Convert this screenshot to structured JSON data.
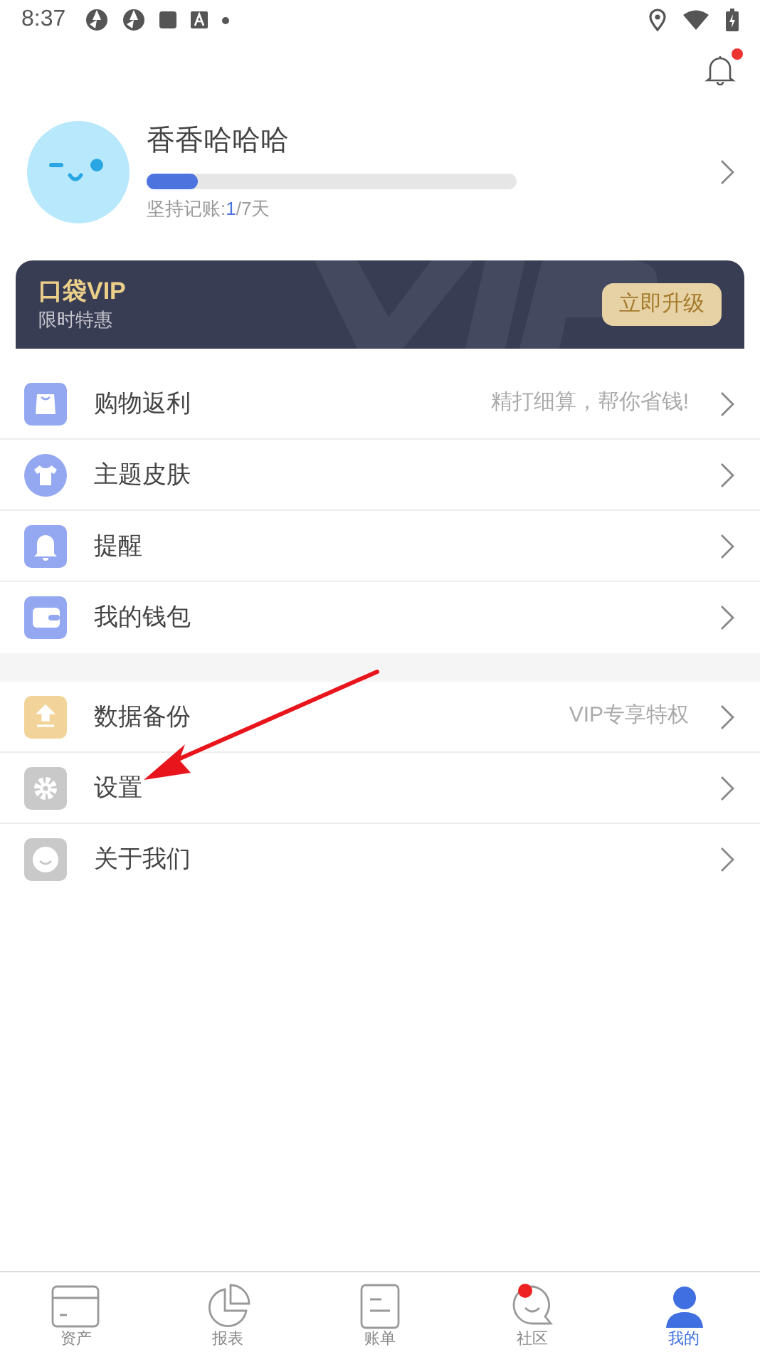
{
  "status_bar": {
    "time": "8:37"
  },
  "notifications": {
    "unread": true
  },
  "profile": {
    "name": "香香哈哈哈",
    "level": 0.14,
    "streak_label": "坚持记账:",
    "streak_current": "1",
    "streak_total": "/7天"
  },
  "vip_banner": {
    "title": "口袋VIP",
    "subtitle": "限时特惠",
    "button": "立即升级"
  },
  "menu_groups": [
    {
      "items": [
        {
          "label": "购物返利",
          "hint": "精打细算，帮你省钱!"
        },
        {
          "label": "主题皮肤"
        },
        {
          "label": "提醒"
        },
        {
          "label": "我的钱包"
        }
      ]
    },
    {
      "items": [
        {
          "label": "数据备份",
          "hint": "VIP专享特权"
        },
        {
          "label": "设置",
          "annotated": true
        },
        {
          "label": "关于我们"
        }
      ]
    }
  ],
  "tab_bar": [
    {
      "label": "资产",
      "selected": false,
      "badge": false
    },
    {
      "label": "报表",
      "selected": false,
      "badge": false
    },
    {
      "label": "账单",
      "selected": false,
      "badge": false
    },
    {
      "label": "社区",
      "selected": false,
      "badge": true
    },
    {
      "label": "我的",
      "selected": true,
      "badge": false
    }
  ]
}
